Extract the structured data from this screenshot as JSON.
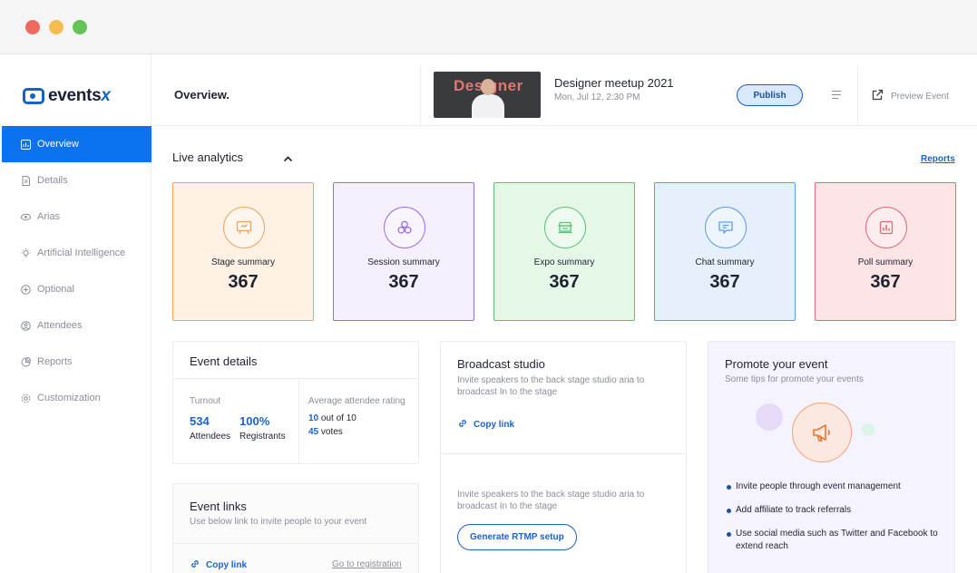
{
  "app": {
    "logo_prefix": "events",
    "logo_suffix": "x"
  },
  "sidebar": {
    "items": [
      {
        "label": "Overview",
        "icon": "chart-icon",
        "active": true
      },
      {
        "label": "Details",
        "icon": "document-icon"
      },
      {
        "label": "Arias",
        "icon": "eye-icon"
      },
      {
        "label": "Artificial Intelligence",
        "icon": "bulb-icon"
      },
      {
        "label": "Optional",
        "icon": "plus-circle-icon"
      },
      {
        "label": "Attendees",
        "icon": "user-circle-icon"
      },
      {
        "label": "Reports",
        "icon": "pie-icon"
      },
      {
        "label": "Customization",
        "icon": "gear-icon"
      }
    ]
  },
  "header": {
    "page_title": "Overview.",
    "thumb_word": "Designer",
    "event_name": "Designer meetup 2021",
    "event_date": "Mon, Jul 12, 2:30 PM",
    "publish_label": "Publish",
    "preview_label": "Preview Event"
  },
  "analytics": {
    "title": "Live analytics",
    "reports_link": "Reports",
    "cards": [
      {
        "label": "Stage summary",
        "value": "367",
        "icon": "presentation-icon",
        "color": "#f0a25a",
        "bg": "#fff1e3"
      },
      {
        "label": "Session summary",
        "value": "367",
        "icon": "people-icon",
        "color": "#9b6ee0",
        "bg": "#f6f0fe"
      },
      {
        "label": "Expo summary",
        "value": "367",
        "icon": "booth-icon",
        "color": "#5cc174",
        "bg": "#e5f8e8"
      },
      {
        "label": "Chat summary",
        "value": "367",
        "icon": "chat-icon",
        "color": "#5f9ae6",
        "bg": "#e6f0fd"
      },
      {
        "label": "Poll summary",
        "value": "367",
        "icon": "poll-icon",
        "color": "#e06a72",
        "bg": "#fde4e6"
      }
    ]
  },
  "event_details": {
    "title": "Event details",
    "turnout_label": "Turnout",
    "attendees_value": "534",
    "attendees_label": "Attendees",
    "registrants_value": "100%",
    "registrants_label": "Registrants",
    "rating_label": "Average attendee rating",
    "rating_value": "10",
    "rating_suffix": "out of 10",
    "votes_value": "45",
    "votes_suffix": "votes"
  },
  "event_links": {
    "title": "Event links",
    "subtitle": "Use below link to invite people to your event",
    "copy_link": "Copy link",
    "registration_link": "Go to registration"
  },
  "broadcast": {
    "title": "Broadcast studio",
    "description": "Invite speakers to the back stage studio aria to broadcast In to the stage",
    "copy_link": "Copy link",
    "description2": "Invite speakers to the back stage studio aria to broadcast In to the stage",
    "rtmp_button": "Generate RTMP setup"
  },
  "promote": {
    "title": "Promote your event",
    "subtitle": "Some tips for promote your events",
    "icon": "megaphone-icon",
    "tips": [
      "Invite people through event management",
      "Add affiliate to track referrals",
      "Use social media such as Twitter and Facebook to extend reach"
    ]
  }
}
